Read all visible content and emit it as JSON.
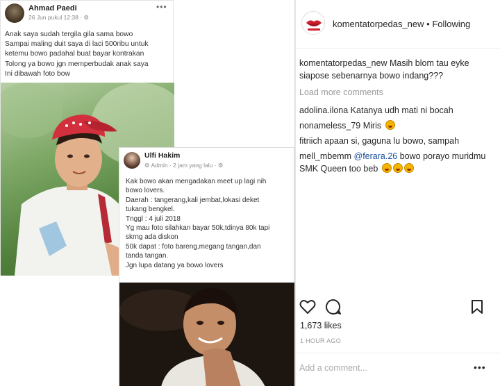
{
  "post1": {
    "name": "Ahmad Paedi",
    "time": "26 Jun pukul 12:38 · ⚙",
    "more": "•••",
    "lines": [
      "Anak saya sudah tergila gila sama bowo",
      "Sampai maling duit saya di laci 500ribu untuk",
      "ketemu bowo padahal buat bayar kontrakan",
      "Tolong ya bowo jgn memperbudak anak saya",
      "Ini dibawah foto bow"
    ]
  },
  "post2": {
    "name": "Ulfi Hakim",
    "meta": "⚙ Admin · 2 jam yang lalu · ⚙",
    "lines": [
      "Kak bowo akan mengadakan meet up lagi nih",
      "bowo lovers.",
      "Daerah : tangerang,kali jembat,lokasi deket",
      "tukang bengkel.",
      "Tnggl : 4 juli 2018",
      "Yg mau foto silahkan bayar 50k,tdinya 80k tapi",
      "skrng ada diskon",
      "50k dapat : foto bareng,megang tangan,dan",
      "tanda tangan.",
      "Jgn lupa datang ya bowo lovers"
    ]
  },
  "instagram": {
    "username": "komentatorpedas_new",
    "dot": " • ",
    "follow_status": "Following",
    "caption_user": "komentatorpedas_new",
    "caption_text": " Masih blom tau eyke siapose sebenarnya bowo indang???",
    "load_more": "Load more comments",
    "comments": [
      {
        "user": "adolina.ilona",
        "text": " Katanya udh mati ni bocah"
      },
      {
        "user": "nonameless_79",
        "text": " Miris"
      },
      {
        "user": "fitriich",
        "text": " apaan si, gaguna lu bowo, sampah"
      }
    ],
    "last_comment": {
      "user": "mell_mbemm",
      "mention": "@ferara.26",
      "text": " bowo porayo muridmu SMK Queen too beb"
    },
    "likes": "1,673 likes",
    "time_ago": "1 HOUR AGO",
    "comment_placeholder": "Add a comment...",
    "comment_more": "•••",
    "icons": [
      "heart-icon",
      "comment-icon",
      "bookmark-icon",
      "ellipsis-icon"
    ]
  }
}
